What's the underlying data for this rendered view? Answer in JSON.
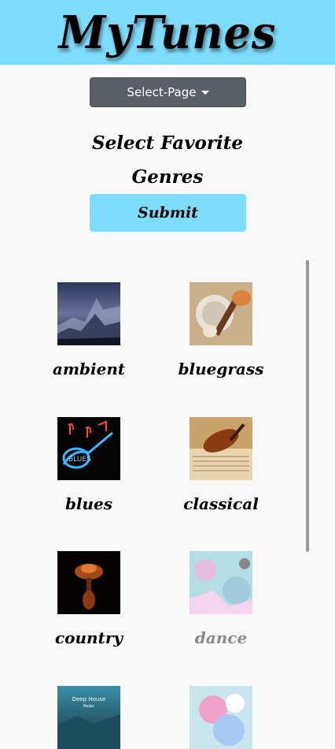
{
  "header": {
    "title": "MyTunes"
  },
  "nav": {
    "select_page_label": "Select-Page"
  },
  "main": {
    "heading_line1": "Select Favorite",
    "heading_line2": "Genres",
    "submit_label": "Submit"
  },
  "genres": [
    {
      "label": "ambient",
      "selected": false
    },
    {
      "label": "bluegrass",
      "selected": false
    },
    {
      "label": "blues",
      "selected": false
    },
    {
      "label": "classical",
      "selected": false
    },
    {
      "label": "country",
      "selected": false
    },
    {
      "label": "dance",
      "selected": true
    },
    {
      "thumb_text_1": "Deep House",
      "thumb_text_2": "Relax"
    },
    {}
  ],
  "colors": {
    "header_bg": "#7edcfd",
    "submit_bg": "#7edcfd",
    "select_bg": "#5a5f66"
  }
}
